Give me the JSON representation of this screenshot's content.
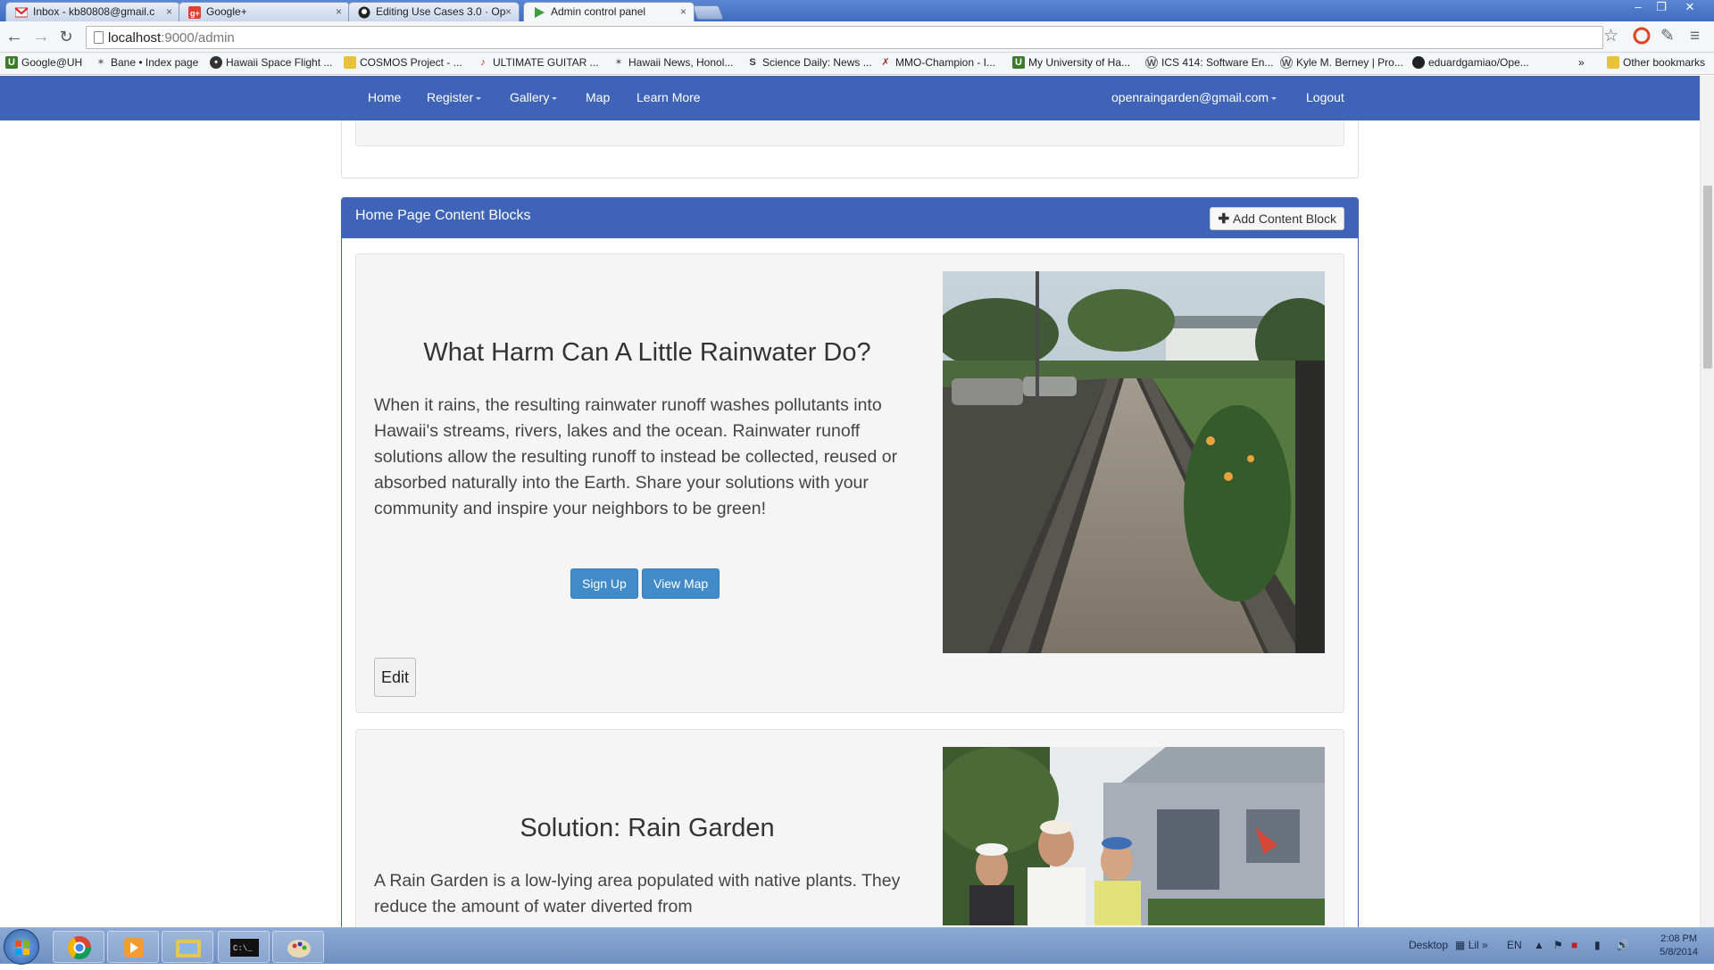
{
  "browser": {
    "tabs": [
      {
        "title": "Inbox - kb80808@gmail.c",
        "icon": "gmail-icon"
      },
      {
        "title": "Google+",
        "icon": "googleplus-icon"
      },
      {
        "title": "Editing Use Cases 3.0 · Op",
        "icon": "github-icon"
      },
      {
        "title": "Admin control panel",
        "icon": "play-icon"
      }
    ],
    "url_host": "localhost",
    "url_path": ":9000/admin",
    "bookmarks": [
      "Google@UH",
      "Bane • Index page",
      "Hawaii Space Flight ...",
      "COSMOS Project - ...",
      "ULTIMATE GUITAR ...",
      "Hawaii News, Honol...",
      "Science Daily: News ...",
      "MMO-Champion - I...",
      "My University of Ha...",
      "ICS 414: Software En...",
      "Kyle M. Berney | Pro...",
      "eduardgamiao/Ope..."
    ],
    "bookmarks_overflow": "»",
    "other_bookmarks": "Other bookmarks"
  },
  "site_nav": {
    "home": "Home",
    "register": "Register",
    "gallery": "Gallery",
    "map": "Map",
    "learn_more": "Learn More",
    "user": "openraingarden@gmail.com",
    "logout": "Logout"
  },
  "content_blocks_panel": {
    "title": "Home Page Content Blocks",
    "add_button": "Add Content Block"
  },
  "blocks": [
    {
      "heading": "What Harm Can A Little Rainwater Do?",
      "body": "When it rains, the resulting rainwater runoff washes pollutants into Hawaii's streams, rivers, lakes and the ocean. Rainwater runoff solutions allow the resulting runoff to instead be collected, reused or absorbed naturally into the Earth. Share your solutions with your community and inspire your neighbors to be green!",
      "signup": "Sign Up",
      "viewmap": "View Map",
      "edit": "Edit"
    },
    {
      "heading": "Solution: Rain Garden",
      "body": "A Rain Garden is a low-lying area populated with native plants. They reduce the amount of water diverted from"
    }
  ],
  "taskbar": {
    "desktop": "Desktop",
    "lang": "EN",
    "time": "2:08 PM",
    "date": "5/8/2014",
    "tray_label": "Lil"
  },
  "colors": {
    "site_nav": "#3f63b6",
    "primary_button": "#428bca"
  }
}
